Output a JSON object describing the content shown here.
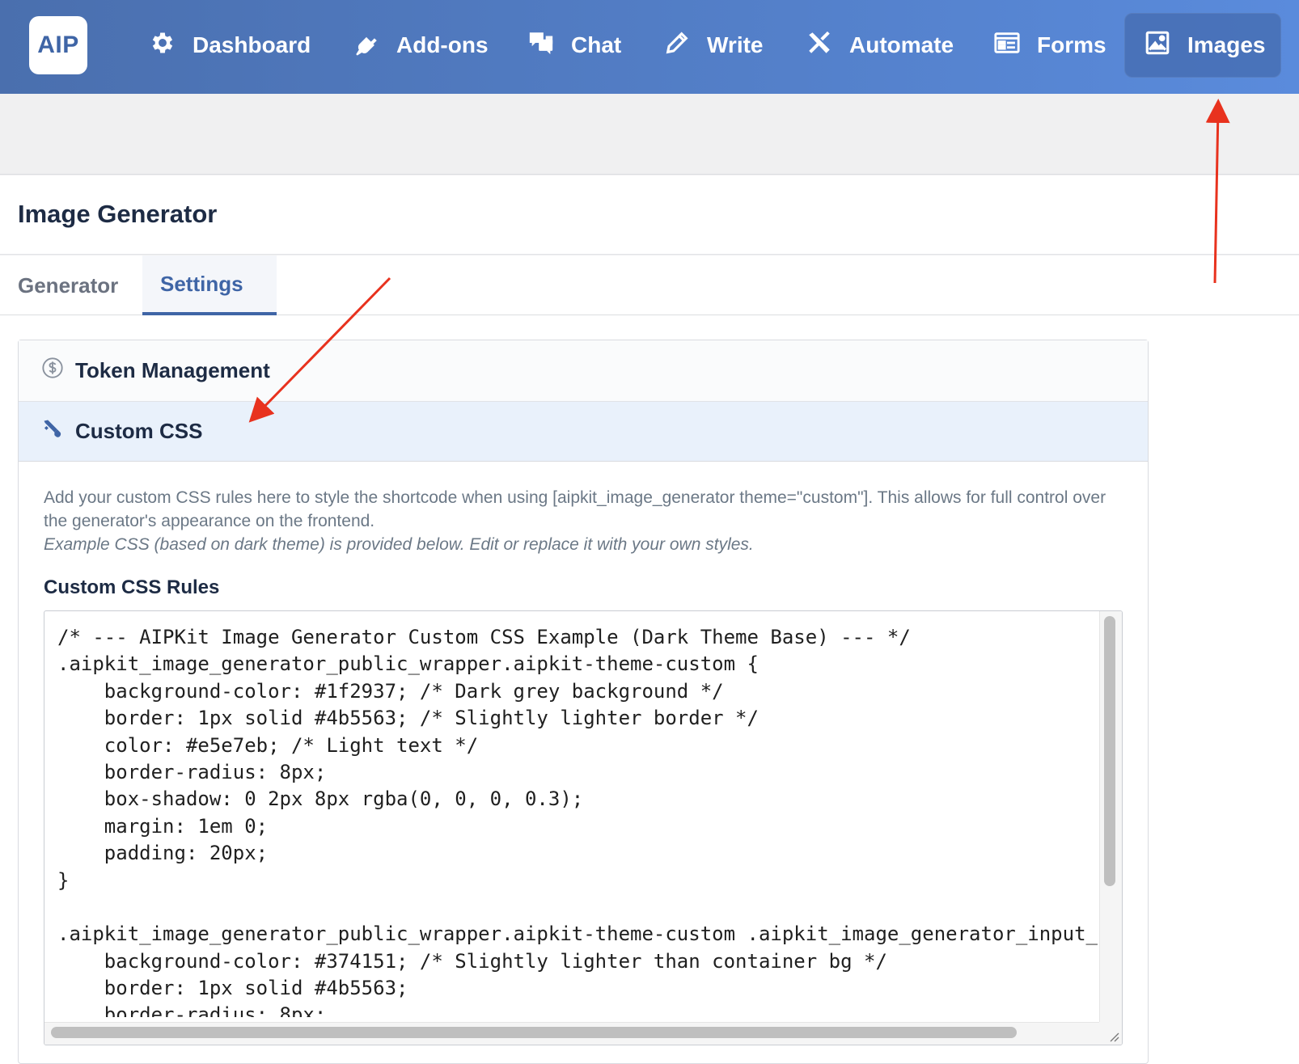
{
  "app": {
    "logo_text": "AIP",
    "accent_color": "#3f65a6",
    "nav_gradient": [
      "#4a6fae",
      "#5a8bdc"
    ]
  },
  "nav": {
    "items": [
      {
        "label": "Dashboard",
        "icon": "gear-icon"
      },
      {
        "label": "Add-ons",
        "icon": "plug-icon"
      },
      {
        "label": "Chat",
        "icon": "chat-bubbles-icon"
      },
      {
        "label": "Write",
        "icon": "pencil-icon"
      },
      {
        "label": "Automate",
        "icon": "tools-icon"
      },
      {
        "label": "Forms",
        "icon": "form-icon"
      },
      {
        "label": "Images",
        "icon": "image-icon",
        "active": true
      }
    ]
  },
  "page": {
    "title": "Image Generator"
  },
  "tabs": [
    {
      "label": "Generator",
      "active": false
    },
    {
      "label": "Settings",
      "active": true
    }
  ],
  "sections": {
    "token": {
      "label": "Token Management",
      "icon": "dollar-circle-icon"
    },
    "css": {
      "label": "Custom CSS",
      "icon": "paint-brush-icon"
    }
  },
  "custom_css": {
    "description": "Add your custom CSS rules here to style the shortcode when using [aipkit_image_generator theme=\"custom\"]. This allows for full control over the generator's appearance on the frontend.",
    "description_italic": "Example CSS (based on dark theme) is provided below. Edit or replace it with your own styles.",
    "rules_label": "Custom CSS Rules",
    "code_lines": [
      "/* --- AIPKit Image Generator Custom CSS Example (Dark Theme Base) --- */",
      ".aipkit_image_generator_public_wrapper.aipkit-theme-custom {",
      "    background-color: #1f2937; /* Dark grey background */",
      "    border: 1px solid #4b5563; /* Slightly lighter border */",
      "    color: #e5e7eb; /* Light text */",
      "    border-radius: 8px;",
      "    box-shadow: 0 2px 8px rgba(0, 0, 0, 0.3);",
      "    margin: 1em 0;",
      "    padding: 20px;",
      "}",
      "",
      ".aipkit_image_generator_public_wrapper.aipkit-theme-custom .aipkit_image_generator_input_",
      "    background-color: #374151; /* Slightly lighter than container bg */",
      "    border: 1px solid #4b5563;",
      "    border-radius: 8px;"
    ]
  },
  "annotations": {
    "arrow_color": "#e8321e"
  }
}
